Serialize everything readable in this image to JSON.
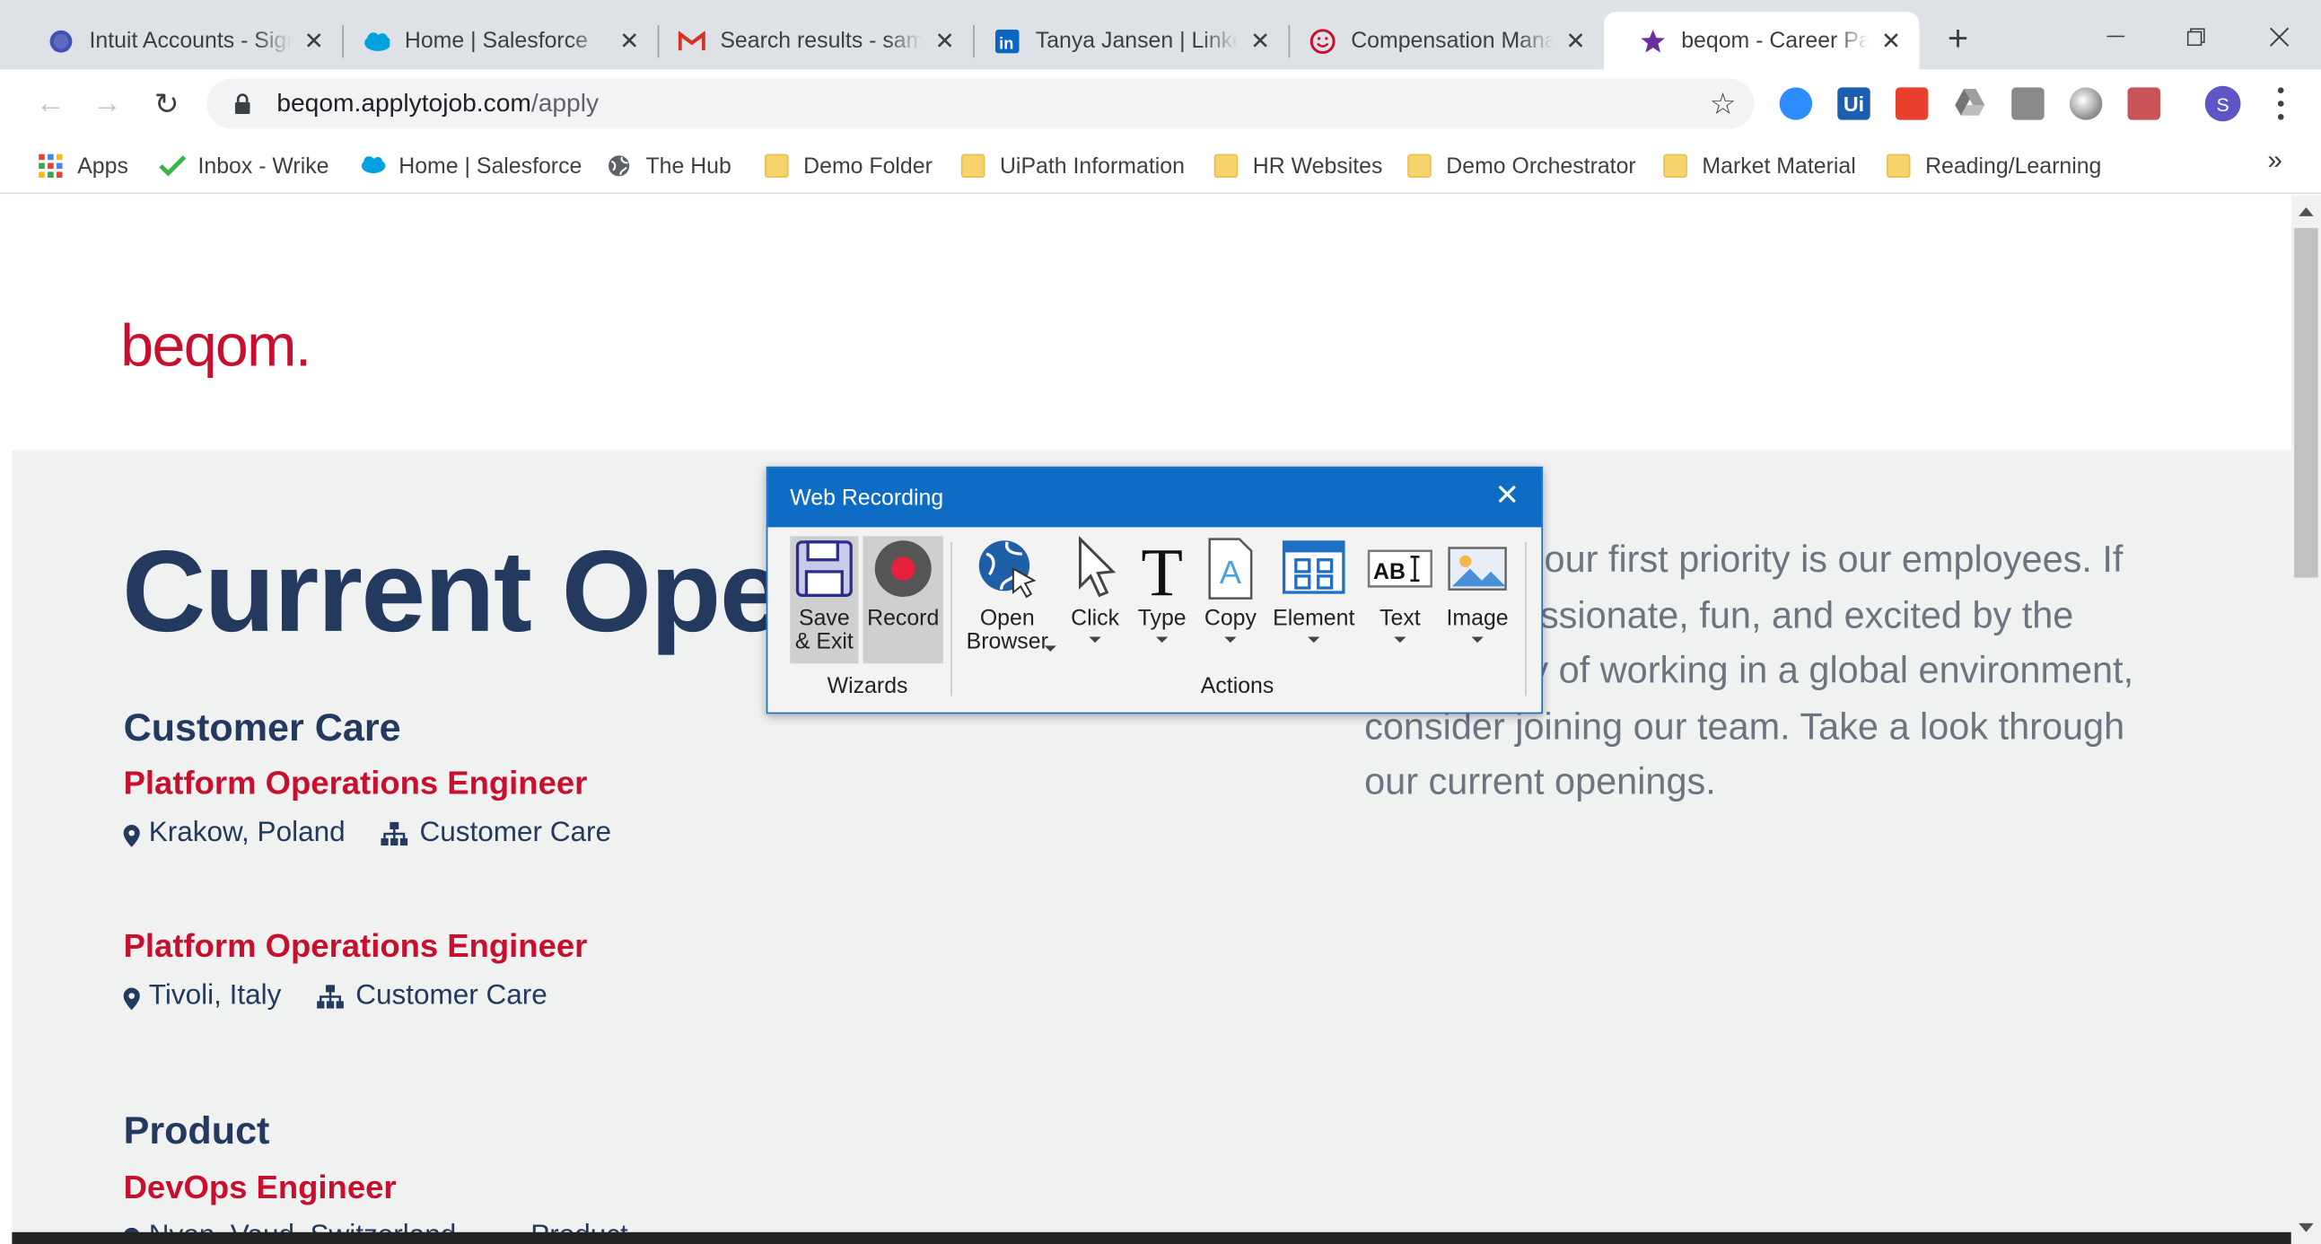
{
  "tabs": [
    {
      "title": "Intuit Accounts - Sign In",
      "icon": "intuit-icon"
    },
    {
      "title": "Home | Salesforce",
      "icon": "salesforce-cloud-icon"
    },
    {
      "title": "Search results - samuel",
      "icon": "gmail-icon"
    },
    {
      "title": "Tanya Jansen | LinkedIn",
      "icon": "linkedin-icon"
    },
    {
      "title": "Compensation Management",
      "icon": "smiley-icon"
    },
    {
      "title": "beqom - Career Page",
      "icon": "purple-star-icon"
    }
  ],
  "address": {
    "host": "beqom.applytojob.com",
    "path": "/apply"
  },
  "avatar_letter": "S",
  "bookmarks": [
    {
      "label": "Apps",
      "icon": "apps-grid-icon"
    },
    {
      "label": "Inbox - Wrike",
      "icon": "wrike-check-icon"
    },
    {
      "label": "Home | Salesforce",
      "icon": "salesforce-cloud-icon"
    },
    {
      "label": "The Hub",
      "icon": "globe-icon"
    },
    {
      "label": "Demo Folder",
      "icon": "folder-icon"
    },
    {
      "label": "UiPath Information",
      "icon": "folder-icon"
    },
    {
      "label": "HR Websites",
      "icon": "folder-icon"
    },
    {
      "label": "Demo Orchestrator",
      "icon": "folder-icon"
    },
    {
      "label": "Market Material",
      "icon": "folder-icon"
    },
    {
      "label": "Reading/Learning",
      "icon": "folder-icon"
    }
  ],
  "page": {
    "logo": "beqom.",
    "heading": "Current Openings",
    "intro": "At beqom, our first priority is our employees. If you are passionate, fun, and excited by the opportunity of working in a global environment, consider joining our team. Take a look through our current openings.",
    "sections": [
      {
        "category": "Customer Care",
        "jobs": [
          {
            "title": "Platform Operations Engineer",
            "location": "Krakow, Poland",
            "department": "Customer Care"
          },
          {
            "title": "Platform Operations Engineer",
            "location": "Tivoli, Italy",
            "department": "Customer Care"
          }
        ]
      },
      {
        "category": "Product",
        "jobs": [
          {
            "title": "DevOps Engineer",
            "location": "Nyon, Vaud, Switzerland",
            "department": "Product"
          }
        ]
      }
    ]
  },
  "dialog": {
    "title": "Web Recording",
    "wizards_label": "Wizards",
    "actions_label": "Actions",
    "buttons": {
      "save_exit": "Save\n& Exit",
      "record": "Record",
      "open_browser": "Open\nBrowser",
      "click": "Click",
      "type": "Type",
      "copy": "Copy",
      "element": "Element",
      "text": "Text",
      "image": "Image"
    },
    "colors": {
      "titlebar": "#0e6cc4",
      "record": "#e8203f"
    }
  },
  "colors": {
    "brand_red": "#c8102e",
    "navy": "#233a5e"
  }
}
